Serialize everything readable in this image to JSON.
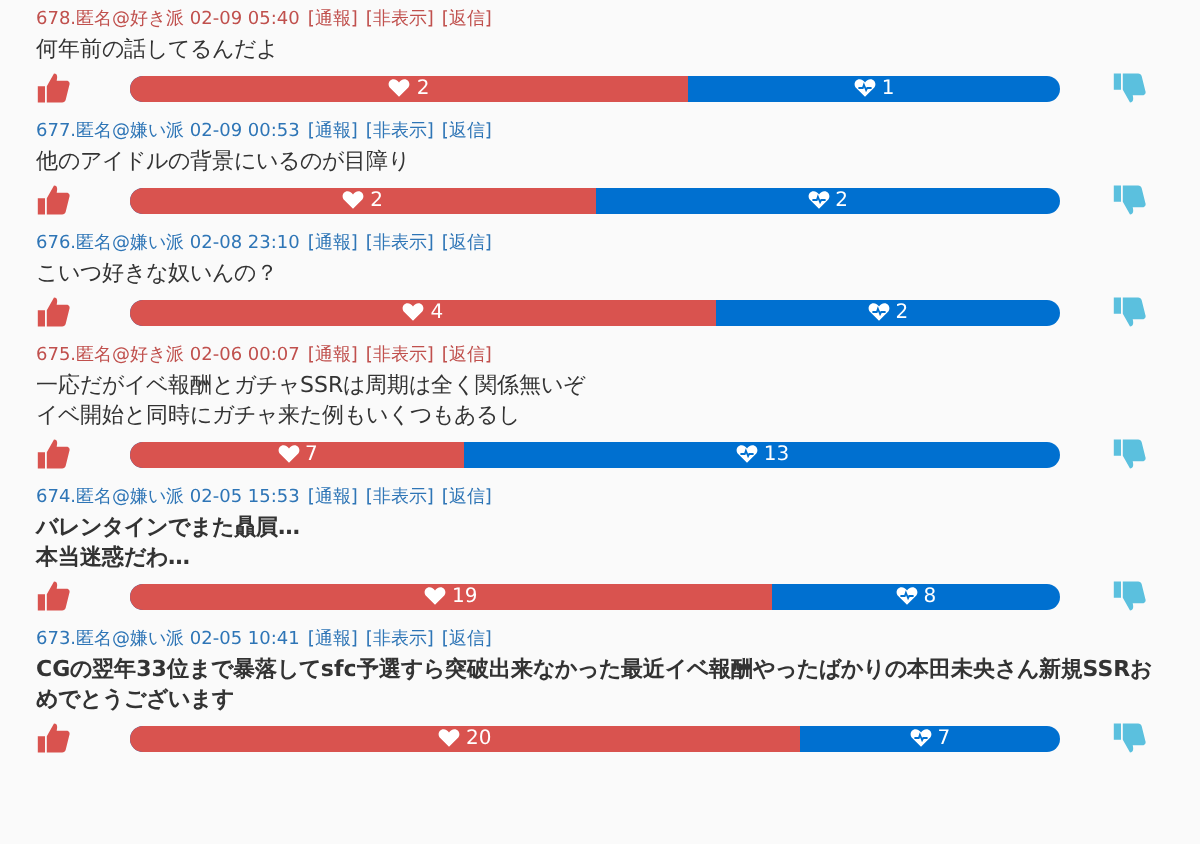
{
  "posts": [
    {
      "author": "678.匿名@好き派 02-09 05:40",
      "color": "#c0504d",
      "links": [
        "[通報]",
        "[非表示]",
        "[返信]"
      ],
      "lines": [
        "何年前の話してるんだよ"
      ],
      "bold": false,
      "likes": "2",
      "dislikes": "1",
      "level": 0.6
    },
    {
      "author": "677.匿名@嫌い派 02-09 00:53",
      "color": "#2e75b6",
      "links": [
        "[通報]",
        "[非表示]",
        "[返信]"
      ],
      "lines": [
        "他のアイドルの背景にいるのが目障り"
      ],
      "bold": false,
      "likes": "2",
      "dislikes": "2",
      "level": 0.5
    },
    {
      "author": "676.匿名@嫌い派 02-08 23:10",
      "color": "#2e75b6",
      "links": [
        "[通報]",
        "[非表示]",
        "[返信]"
      ],
      "lines": [
        "こいつ好きな奴いんの？"
      ],
      "bold": false,
      "likes": "4",
      "dislikes": "2",
      "level": 0.63
    },
    {
      "author": "675.匿名@好き派 02-06 00:07",
      "color": "#c0504d",
      "links": [
        "[通報]",
        "[非表示]",
        "[返信]"
      ],
      "lines": [
        "一応だがイベ報酬とガチャSSRは周期は全く関係無いぞ",
        "イベ開始と同時にガチャ来た例もいくつもあるし"
      ],
      "bold": false,
      "likes": "7",
      "dislikes": "13",
      "level": 0.36
    },
    {
      "author": "674.匿名@嫌い派 02-05 15:53",
      "color": "#2e75b6",
      "links": [
        "[通報]",
        "[非表示]",
        "[返信]"
      ],
      "lines": [
        "バレンタインでまた贔屓…",
        "本当迷惑だわ…"
      ],
      "bold": true,
      "likes": "19",
      "dislikes": "8",
      "level": 0.69
    },
    {
      "author": "673.匿名@嫌い派 02-05 10:41",
      "color": "#2e75b6",
      "links": [
        "[通報]",
        "[非表示]",
        "[返信]"
      ],
      "lines": [
        "CGの翌年33位まで暴落してsfc予選すら突破出来なかった最近イベ報酬やったばかりの本田未央さん新規SSRおめでとうございます"
      ],
      "bold": true,
      "likes": "20",
      "dislikes": "7",
      "level": 0.72
    }
  ]
}
